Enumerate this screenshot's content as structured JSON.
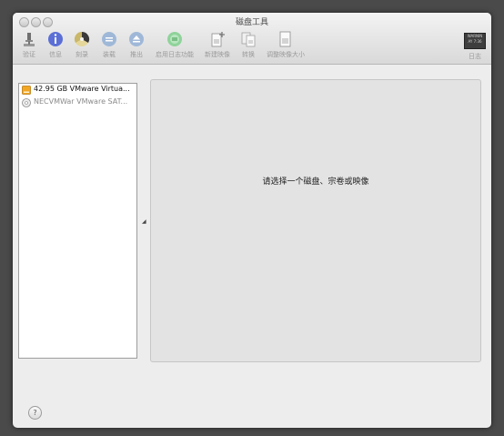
{
  "window": {
    "title": "磁盘工具"
  },
  "toolbar": {
    "items": [
      {
        "label": "验证",
        "icon": "microscope-icon"
      },
      {
        "label": "信息",
        "icon": "info-icon"
      },
      {
        "label": "刻录",
        "icon": "burn-icon"
      },
      {
        "label": "装载",
        "icon": "mount-icon"
      },
      {
        "label": "推出",
        "icon": "eject-icon"
      },
      {
        "label": "启用日志功能",
        "icon": "journal-icon"
      },
      {
        "label": "新建映像",
        "icon": "new-image-icon"
      },
      {
        "label": "转换",
        "icon": "convert-icon"
      },
      {
        "label": "调整映像大小",
        "icon": "resize-image-icon"
      }
    ],
    "log": {
      "label": "日志",
      "icon": "log-icon",
      "badge": "WARNIN\nAY 7:36"
    }
  },
  "sidebar": {
    "items": [
      {
        "label": "42.95 GB VMware Virtua...",
        "icon": "hard-disk-icon"
      },
      {
        "label": "NECVMWar VMware SAT...",
        "icon": "optical-drive-icon"
      }
    ]
  },
  "main": {
    "prompt": "请选择一个磁盘、宗卷或映像"
  },
  "help": {
    "label": "?"
  },
  "colors": {
    "window_bg": "#ededed",
    "panel_bg": "#e3e3e3",
    "desktop_bg": "#4a4a4a"
  }
}
